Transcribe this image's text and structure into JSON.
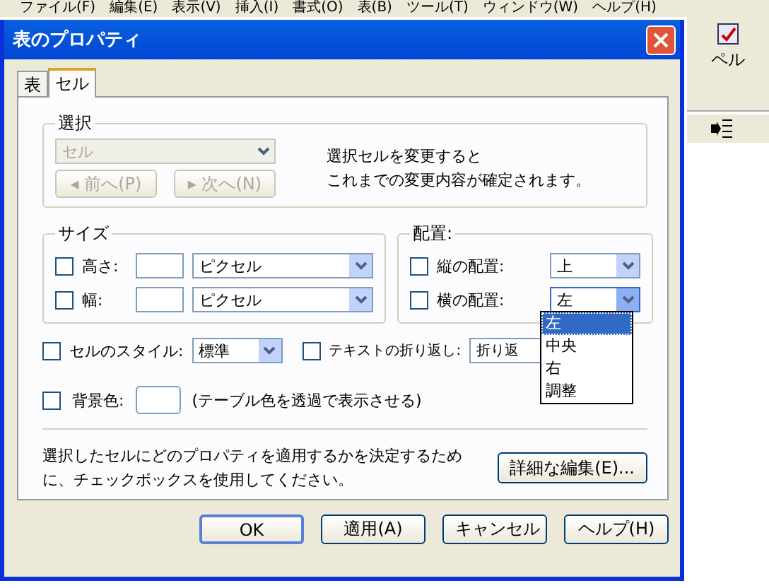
{
  "app_menu": [
    "ファイル(F)",
    "編集(E)",
    "表示(V)",
    "挿入(I)",
    "書式(O)",
    "表(B)",
    "ツール(T)",
    "ウィンドウ(W)",
    "ヘルプ(H)"
  ],
  "toolbar": {
    "label": "ペル"
  },
  "dialog": {
    "title": "表のプロパティ",
    "tabs": [
      {
        "label": "表",
        "selected": false
      },
      {
        "label": "セル",
        "selected": true
      }
    ],
    "selection": {
      "legend": "選択",
      "select": {
        "value": "セル",
        "disabled": true
      },
      "prev": {
        "label": "◂ 前へ(P)",
        "disabled": true
      },
      "next": {
        "label": "▸ 次へ(N)",
        "disabled": true
      },
      "note_lines": [
        "選択セルを変更すると",
        "これまでの変更内容が確定されます。"
      ]
    },
    "size": {
      "legend": "サイズ",
      "rows": [
        {
          "label": "高さ:",
          "checked": false,
          "unit": "ピクセル"
        },
        {
          "label": "幅:",
          "checked": false,
          "unit": "ピクセル"
        }
      ]
    },
    "alignment": {
      "legend": "配置:",
      "rows": [
        {
          "label": "縦の配置:",
          "checked": false,
          "value": "上",
          "open": false
        },
        {
          "label": "横の配置:",
          "checked": false,
          "value": "左",
          "open": true
        }
      ],
      "options": [
        {
          "label": "左",
          "selected": true
        },
        {
          "label": "中央",
          "selected": false
        },
        {
          "label": "右",
          "selected": false
        },
        {
          "label": "調整",
          "selected": false
        }
      ]
    },
    "cell_style": {
      "label": "セルのスタイル:",
      "checked": false,
      "value": "標準"
    },
    "wrap": {
      "label": "テキストの折り返し:",
      "checked": false,
      "value": "折り返"
    },
    "background": {
      "label": "背景色:",
      "checked": false,
      "note": "(テーブル色を透過で表示させる)"
    },
    "info": "選択したセルにどのプロパティを適用するかを決定するために、チェックボックスを使用してください。",
    "advanced_button": "詳細な編集(E)...",
    "buttons": [
      "OK",
      "適用(A)",
      "キャンセル",
      "ヘルプ(H)"
    ]
  }
}
